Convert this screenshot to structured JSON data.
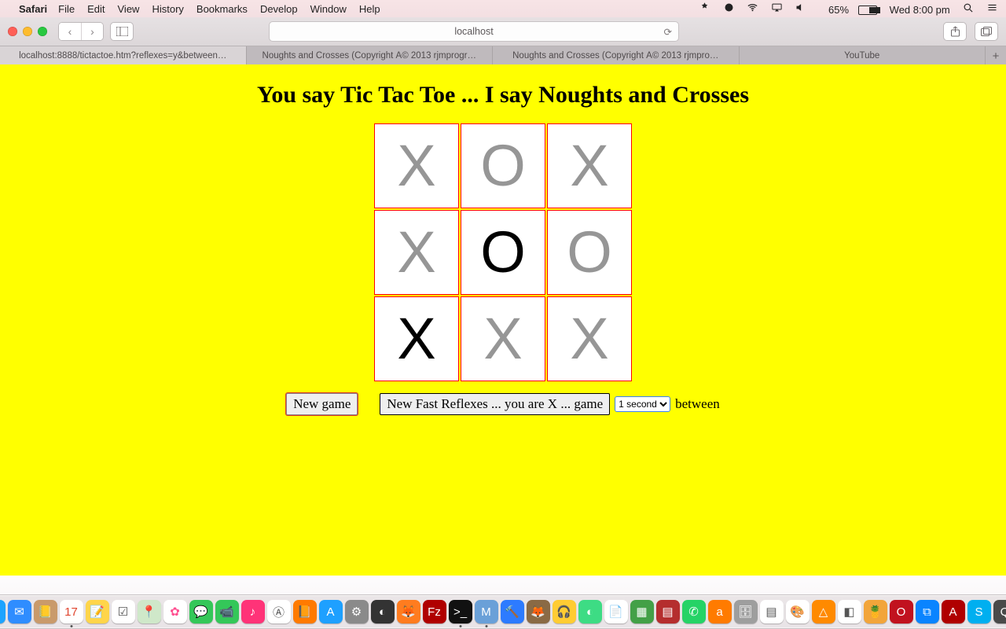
{
  "menubar": {
    "app": "Safari",
    "items": [
      "File",
      "Edit",
      "View",
      "History",
      "Bookmarks",
      "Develop",
      "Window",
      "Help"
    ],
    "battery_pct": "65%",
    "clock": "Wed 8:00 pm"
  },
  "toolbar": {
    "address": "localhost"
  },
  "tabs": [
    {
      "label": "localhost:8888/tictactoe.htm?reflexes=y&between…",
      "active": true
    },
    {
      "label": "Noughts and Crosses (Copyright Â© 2013 rjmprogr…",
      "active": false
    },
    {
      "label": "Noughts and Crosses (Copyright Â© 2013 rjmpro…",
      "active": false
    },
    {
      "label": "YouTube",
      "active": false
    }
  ],
  "page": {
    "title": "You say Tic Tac Toe ... I say Noughts and Crosses",
    "board": [
      [
        {
          "v": "X",
          "black": false
        },
        {
          "v": "O",
          "black": false
        },
        {
          "v": "X",
          "black": false
        }
      ],
      [
        {
          "v": "X",
          "black": false
        },
        {
          "v": "O",
          "black": true
        },
        {
          "v": "O",
          "black": false
        }
      ],
      [
        {
          "v": "X",
          "black": true
        },
        {
          "v": "X",
          "black": false
        },
        {
          "v": "X",
          "black": false
        }
      ]
    ],
    "controls": {
      "new_game": "New game",
      "new_reflex": "New Fast Reflexes ... you are X ... game",
      "interval_selected": "1 second",
      "suffix": "between"
    }
  },
  "dock": {
    "apps": [
      {
        "name": "finder",
        "c": "#2aa0ff",
        "g": "🙂",
        "run": true
      },
      {
        "name": "siri",
        "c": "#111",
        "g": "◯"
      },
      {
        "name": "launchpad",
        "c": "#8a8a8a",
        "g": "🚀"
      },
      {
        "name": "safari",
        "c": "#1da3ff",
        "g": "🧭",
        "run": true
      },
      {
        "name": "mail",
        "c": "#2f8dff",
        "g": "✉︎"
      },
      {
        "name": "contacts",
        "c": "#c99a6b",
        "g": "📒"
      },
      {
        "name": "calendar",
        "c": "#ffffff",
        "g": "17",
        "tc": "#e0452f",
        "run": true
      },
      {
        "name": "notes",
        "c": "#ffd54a",
        "g": "📝"
      },
      {
        "name": "reminders",
        "c": "#fff",
        "g": "☑︎",
        "tc": "#555"
      },
      {
        "name": "maps",
        "c": "#cfe8c9",
        "g": "📍"
      },
      {
        "name": "photos",
        "c": "#fff",
        "g": "✿",
        "tc": "#ff4f90"
      },
      {
        "name": "messages",
        "c": "#34c759",
        "g": "💬"
      },
      {
        "name": "facetime",
        "c": "#34c759",
        "g": "📹"
      },
      {
        "name": "itunes",
        "c": "#ff3378",
        "g": "♪"
      },
      {
        "name": "mas",
        "c": "#fff",
        "g": "Ⓐ",
        "tc": "#555"
      },
      {
        "name": "ibooks",
        "c": "#ff7a00",
        "g": "📙"
      },
      {
        "name": "appstore",
        "c": "#1ea0ff",
        "g": "A"
      },
      {
        "name": "prefs",
        "c": "#8a8a8a",
        "g": "⚙︎"
      },
      {
        "name": "dashboard",
        "c": "#333",
        "g": "◐"
      },
      {
        "name": "firefox",
        "c": "#ff7c1f",
        "g": "🦊"
      },
      {
        "name": "filezilla",
        "c": "#b00000",
        "g": "Fz"
      },
      {
        "name": "terminal",
        "c": "#111",
        "g": ">_",
        "run": true
      },
      {
        "name": "mamp",
        "c": "#6aa0d8",
        "g": "M",
        "run": true
      },
      {
        "name": "xcode",
        "c": "#2d7bff",
        "g": "🔨"
      },
      {
        "name": "gimp",
        "c": "#8a6a45",
        "g": "🦊"
      },
      {
        "name": "audacity",
        "c": "#ffcc33",
        "g": "🎧"
      },
      {
        "name": "android",
        "c": "#3ddc84",
        "g": "◐"
      },
      {
        "name": "libre",
        "c": "#fff",
        "g": "📄",
        "tc": "#666"
      },
      {
        "name": "calc",
        "c": "#43a047",
        "g": "▦"
      },
      {
        "name": "impress",
        "c": "#b52e2e",
        "g": "▤"
      },
      {
        "name": "whatsapp",
        "c": "#25d366",
        "g": "✆"
      },
      {
        "name": "avast",
        "c": "#ff7b00",
        "g": "a"
      },
      {
        "name": "utility",
        "c": "#9e9e9e",
        "g": "🗄"
      },
      {
        "name": "ms1",
        "c": "#fff",
        "g": "▤",
        "tc": "#555"
      },
      {
        "name": "paint",
        "c": "#fff",
        "g": "🎨",
        "tc": "#555"
      },
      {
        "name": "vlc",
        "c": "#ff8a00",
        "g": "△"
      },
      {
        "name": "ms2",
        "c": "#fff",
        "g": "◧",
        "tc": "#555"
      },
      {
        "name": "handbrake",
        "c": "#f2a53a",
        "g": "🍍"
      },
      {
        "name": "opera",
        "c": "#c1121f",
        "g": "O"
      },
      {
        "name": "vscode",
        "c": "#0a84ff",
        "g": "⧉"
      },
      {
        "name": "acrobat",
        "c": "#b00000",
        "g": "A"
      },
      {
        "name": "skype",
        "c": "#00aff0",
        "g": "S"
      },
      {
        "name": "quicktime",
        "c": "#4a4a4a",
        "g": "Q"
      },
      {
        "name": "chrome",
        "c": "#fff",
        "g": "◉",
        "tc": "#f4b400",
        "run": true
      }
    ],
    "tray": [
      {
        "name": "downloads",
        "c": "#fff",
        "g": "⬇︎",
        "tc": "#777"
      },
      {
        "name": "trash",
        "c": "#d0cbcd",
        "g": "🗑",
        "tc": "#666"
      }
    ]
  }
}
